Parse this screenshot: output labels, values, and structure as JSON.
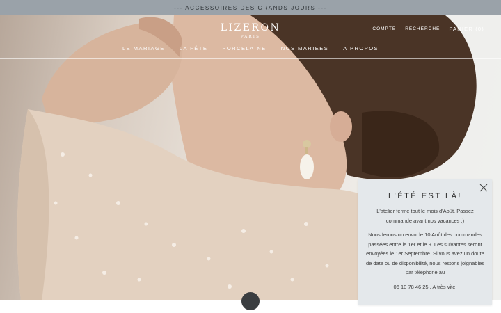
{
  "announcement": {
    "text": "--- ACCESSOIRES DES GRANDS JOURS ---"
  },
  "brand": {
    "name": "LIZERON",
    "city": "PARIS"
  },
  "account_nav": {
    "account": "COMPTE",
    "search": "RECHERCHE",
    "cart": "PANIER (0)"
  },
  "main_nav": {
    "items": [
      {
        "label": "LE MARIAGE"
      },
      {
        "label": "LA FÊTE"
      },
      {
        "label": "PORCELAINE"
      },
      {
        "label": "NOS MARIEES"
      },
      {
        "label": "A PROPOS"
      }
    ]
  },
  "popup": {
    "title": "L'ÉTÉ EST LÀ!",
    "paragraph_1": "L'atelier ferme tout le mois d'Août. Passez commande avant nos vacances :)",
    "paragraph_2": "Nous ferons un envoi le 10 Août des commandes passées entre le 1er et le 9. Les suivantes seront envoyées le 1er Septembre. Si vous avez un doute de date ou de disponibilité, nous restons joignables par téléphone au",
    "paragraph_3": "06 10 78 46 25 . A très vite!",
    "close_icon": "close-icon"
  },
  "colors": {
    "announcement_bg": "#9aa2a9",
    "popup_bg": "#e4e8eb",
    "scroll_button": "#3a3d40"
  }
}
